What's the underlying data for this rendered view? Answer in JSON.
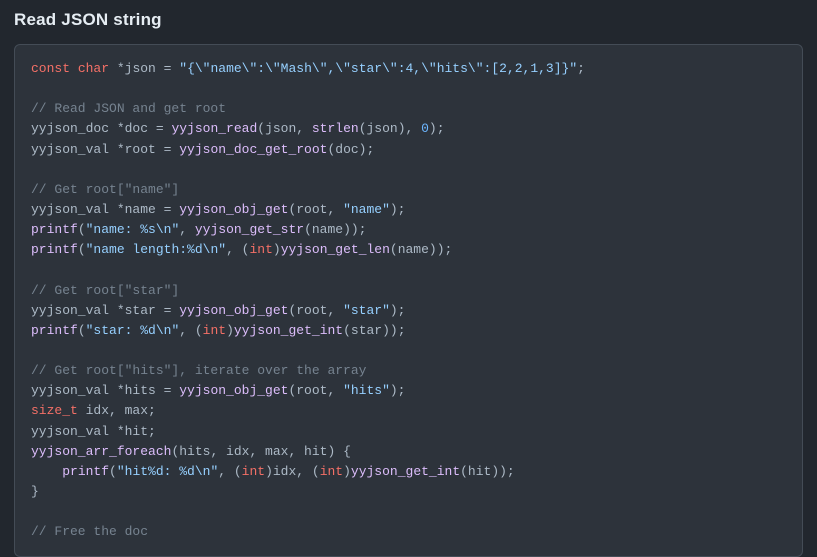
{
  "heading": "Read JSON string",
  "code": {
    "tokens": [
      [
        [
          "kw",
          "const"
        ],
        [
          "",
          ""
        ],
        [
          "",
          ""
        ],
        [
          "id",
          " "
        ],
        [
          "kw",
          "char"
        ],
        [
          "id",
          " *json = "
        ],
        [
          "str",
          "\"{\\\"name\\\":\\\"Mash\\\",\\\"star\\\":4,\\\"hits\\\":[2,2,1,3]}\""
        ],
        [
          "punc",
          ";"
        ]
      ],
      [
        [
          "id",
          ""
        ]
      ],
      [
        [
          "com",
          "// Read JSON and get root"
        ]
      ],
      [
        [
          "id",
          "yyjson_doc *doc = "
        ],
        [
          "fn",
          "yyjson_read"
        ],
        [
          "punc",
          "(json, "
        ],
        [
          "fn",
          "strlen"
        ],
        [
          "punc",
          "(json), "
        ],
        [
          "num",
          "0"
        ],
        [
          "punc",
          ");"
        ]
      ],
      [
        [
          "id",
          "yyjson_val *root = "
        ],
        [
          "fn",
          "yyjson_doc_get_root"
        ],
        [
          "punc",
          "(doc);"
        ]
      ],
      [
        [
          "id",
          ""
        ]
      ],
      [
        [
          "com",
          "// Get root[\"name\"]"
        ]
      ],
      [
        [
          "id",
          "yyjson_val *name = "
        ],
        [
          "fn",
          "yyjson_obj_get"
        ],
        [
          "punc",
          "(root, "
        ],
        [
          "str",
          "\"name\""
        ],
        [
          "punc",
          ");"
        ]
      ],
      [
        [
          "fn",
          "printf"
        ],
        [
          "punc",
          "("
        ],
        [
          "str",
          "\"name: %s\\n\""
        ],
        [
          "punc",
          ", "
        ],
        [
          "fn",
          "yyjson_get_str"
        ],
        [
          "punc",
          "(name));"
        ]
      ],
      [
        [
          "fn",
          "printf"
        ],
        [
          "punc",
          "("
        ],
        [
          "str",
          "\"name length:%d\\n\""
        ],
        [
          "punc",
          ", ("
        ],
        [
          "kw",
          "int"
        ],
        [
          "punc",
          ")"
        ],
        [
          "fn",
          "yyjson_get_len"
        ],
        [
          "punc",
          "(name));"
        ]
      ],
      [
        [
          "id",
          ""
        ]
      ],
      [
        [
          "com",
          "// Get root[\"star\"]"
        ]
      ],
      [
        [
          "id",
          "yyjson_val *star = "
        ],
        [
          "fn",
          "yyjson_obj_get"
        ],
        [
          "punc",
          "(root, "
        ],
        [
          "str",
          "\"star\""
        ],
        [
          "punc",
          ");"
        ]
      ],
      [
        [
          "fn",
          "printf"
        ],
        [
          "punc",
          "("
        ],
        [
          "str",
          "\"star: %d\\n\""
        ],
        [
          "punc",
          ", ("
        ],
        [
          "kw",
          "int"
        ],
        [
          "punc",
          ")"
        ],
        [
          "fn",
          "yyjson_get_int"
        ],
        [
          "punc",
          "(star));"
        ]
      ],
      [
        [
          "id",
          ""
        ]
      ],
      [
        [
          "com",
          "// Get root[\"hits\"], iterate over the array"
        ]
      ],
      [
        [
          "id",
          "yyjson_val *hits = "
        ],
        [
          "fn",
          "yyjson_obj_get"
        ],
        [
          "punc",
          "(root, "
        ],
        [
          "str",
          "\"hits\""
        ],
        [
          "punc",
          ");"
        ]
      ],
      [
        [
          "kw",
          "size_t"
        ],
        [
          "id",
          " idx, max;"
        ]
      ],
      [
        [
          "id",
          "yyjson_val *hit;"
        ]
      ],
      [
        [
          "fn",
          "yyjson_arr_foreach"
        ],
        [
          "punc",
          "(hits, idx, max, hit) {"
        ]
      ],
      [
        [
          "id",
          "    "
        ],
        [
          "fn",
          "printf"
        ],
        [
          "punc",
          "("
        ],
        [
          "str",
          "\"hit%d: %d\\n\""
        ],
        [
          "punc",
          ", ("
        ],
        [
          "kw",
          "int"
        ],
        [
          "punc",
          ")idx, ("
        ],
        [
          "kw",
          "int"
        ],
        [
          "punc",
          ")"
        ],
        [
          "fn",
          "yyjson_get_int"
        ],
        [
          "punc",
          "(hit));"
        ]
      ],
      [
        [
          "punc",
          "}"
        ]
      ],
      [
        [
          "id",
          ""
        ]
      ],
      [
        [
          "com",
          "// Free the doc"
        ]
      ]
    ]
  }
}
